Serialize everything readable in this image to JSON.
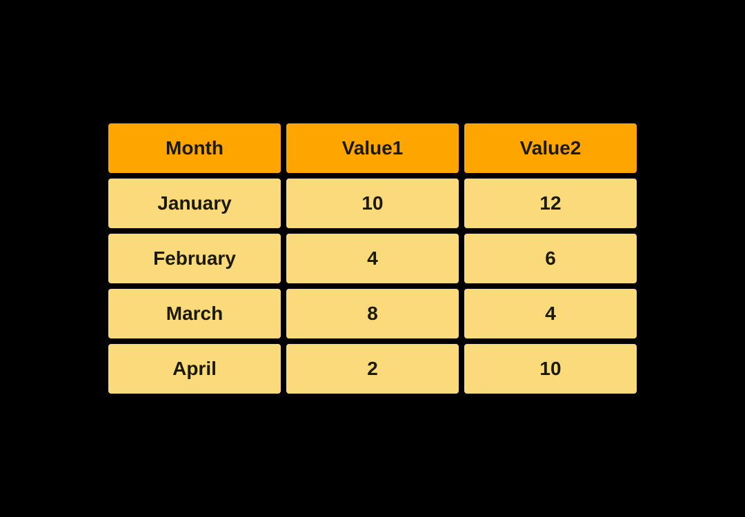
{
  "table": {
    "headers": [
      {
        "label": "Month"
      },
      {
        "label": "Value1"
      },
      {
        "label": "Value2"
      }
    ],
    "rows": [
      {
        "month": "January",
        "value1": "10",
        "value2": "12"
      },
      {
        "month": "February",
        "value1": "4",
        "value2": "6"
      },
      {
        "month": "March",
        "value1": "8",
        "value2": "4"
      },
      {
        "month": "April",
        "value1": "2",
        "value2": "10"
      }
    ]
  }
}
